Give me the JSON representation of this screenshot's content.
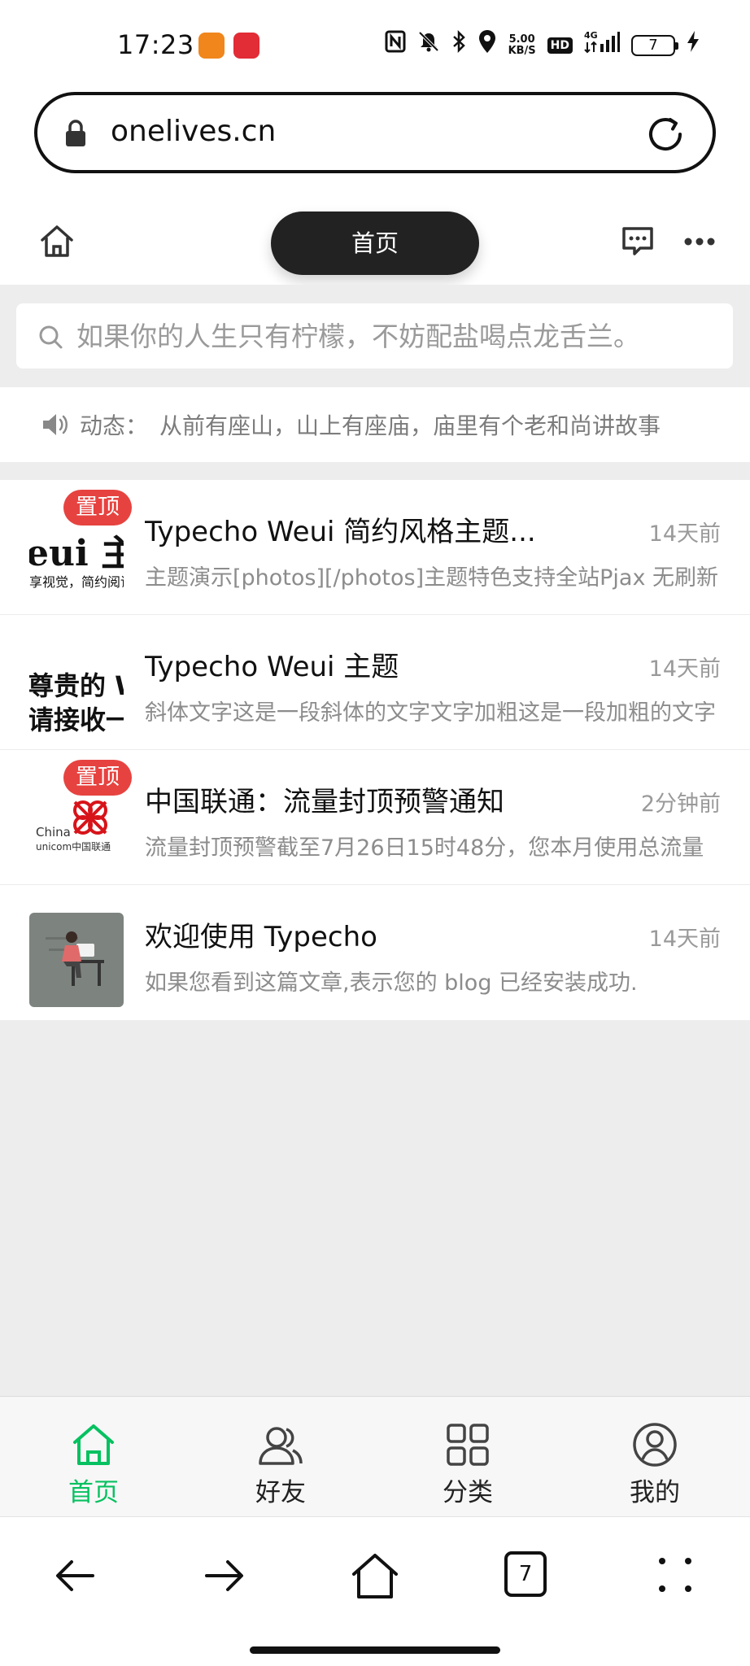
{
  "status_bar": {
    "time": "17:23",
    "net_speed": "5.00",
    "net_speed_unit": "KB/S",
    "hd_label": "HD",
    "signal_label": "4G",
    "battery_level": "7",
    "icons": [
      "nfc-icon",
      "mute-icon",
      "bluetooth-icon",
      "location-icon",
      "signal-icon",
      "charging-icon"
    ]
  },
  "browser": {
    "url": "onelives.cn",
    "tab_count": "7"
  },
  "header": {
    "title": "首页"
  },
  "search": {
    "placeholder": "如果你的人生只有柠檬，不妨配盐喝点龙舌兰。"
  },
  "notice": {
    "label": "动态：",
    "text": "从前有座山，山上有座庙，庙里有个老和尚讲故事"
  },
  "posts": [
    {
      "pinned": true,
      "badge": "置顶",
      "title": "Typecho Weui 简约风格主题...",
      "time": "14天前",
      "excerpt": "主题演示[photos][/photos]主题特色支持全站Pjax 无刷新",
      "thumb_line1": "eui 主题",
      "thumb_line2": "享视觉，简约阅读"
    },
    {
      "pinned": true,
      "badge": "置顶",
      "title": "Typecho Weui 主题",
      "time": "14天前",
      "excerpt": "斜体文字这是一段斜体的文字文字加粗这是一段加粗的文字",
      "thumb_line1": "尊贵的 We",
      "thumb_line2": "请接收一下"
    },
    {
      "pinned": false,
      "title": "中国联通：流量封顶预警通知",
      "time": "2分钟前",
      "excerpt": "流量封顶预警截至7月26日15时48分，您本月使用总流量",
      "thumb_line1": "China",
      "thumb_line2": "unicom中国联通"
    },
    {
      "pinned": false,
      "title": "欢迎使用 Typecho",
      "time": "14天前",
      "excerpt": "如果您看到这篇文章,表示您的 blog 已经安装成功."
    }
  ],
  "tabs": [
    {
      "label": "首页",
      "icon": "home-icon",
      "active": true
    },
    {
      "label": "好友",
      "icon": "friends-icon",
      "active": false
    },
    {
      "label": "分类",
      "icon": "grid-icon",
      "active": false
    },
    {
      "label": "我的",
      "icon": "user-icon",
      "active": false
    }
  ],
  "colors": {
    "accent": "#07c160",
    "pin_badge": "#e64340",
    "background_gray": "#ededed",
    "title_pill": "#222222"
  }
}
